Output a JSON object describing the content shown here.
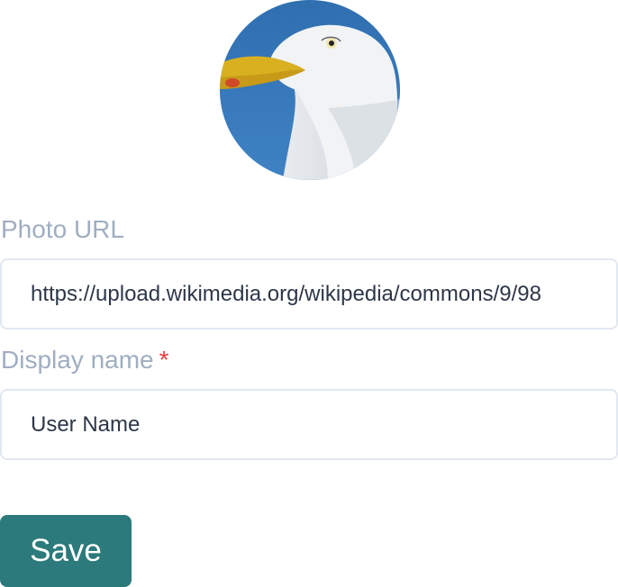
{
  "form": {
    "photo_url_label": "Photo URL",
    "photo_url_value": "https://upload.wikimedia.org/wikipedia/commons/9/98",
    "display_name_label": "Display name",
    "required_marker": "*",
    "display_name_value": "User Name",
    "save_label": "Save"
  },
  "colors": {
    "accent": "#2c7a7b",
    "label": "#a0aec0",
    "required": "#e53e3e",
    "border": "#e2e8f0"
  },
  "icons": {
    "avatar": "seagull-photo"
  }
}
